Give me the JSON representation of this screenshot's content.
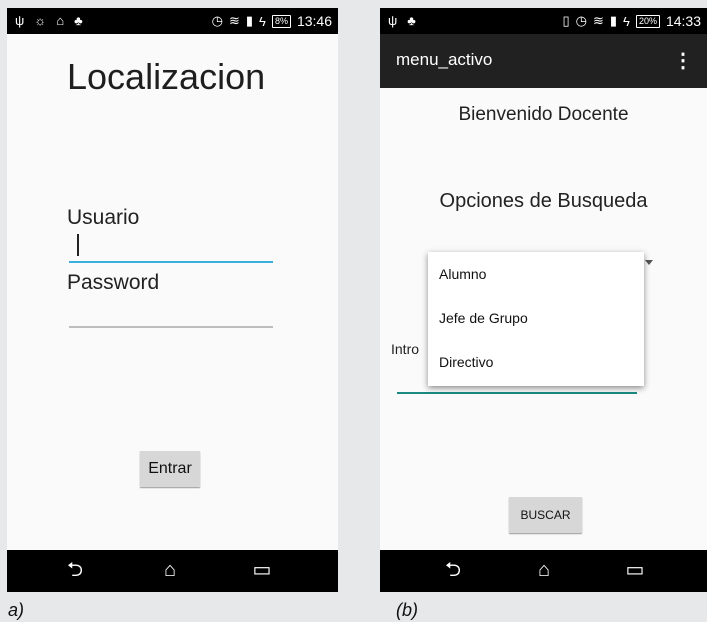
{
  "phone_a": {
    "status": {
      "time": "13:46",
      "battery": "8%"
    },
    "title": "Localizacion",
    "usuario_label": "Usuario",
    "usuario_value": "",
    "password_label": "Password",
    "password_value": "",
    "entrar_button": "Entrar",
    "nav": {
      "back": "back-icon",
      "home": "home-icon",
      "recents": "recents-icon"
    }
  },
  "phone_b": {
    "status": {
      "time": "14:33",
      "battery": "20%"
    },
    "app_title": "menu_activo",
    "welcome": "Bienvenido Docente",
    "options_title": "Opciones de Busqueda",
    "dropdown_options": [
      "Alumno",
      "Jefe de Grupo",
      "Directivo"
    ],
    "intro_label": "Intro",
    "buscar_button": "BUSCAR",
    "nav": {
      "back": "back-icon",
      "home": "home-icon",
      "recents": "recents-icon"
    }
  },
  "captions": {
    "a": "a)",
    "b": "(b)"
  },
  "colors": {
    "focus_underline": "#3ab0e0",
    "teal_underline": "#1a8a80",
    "actionbar": "#212121"
  }
}
